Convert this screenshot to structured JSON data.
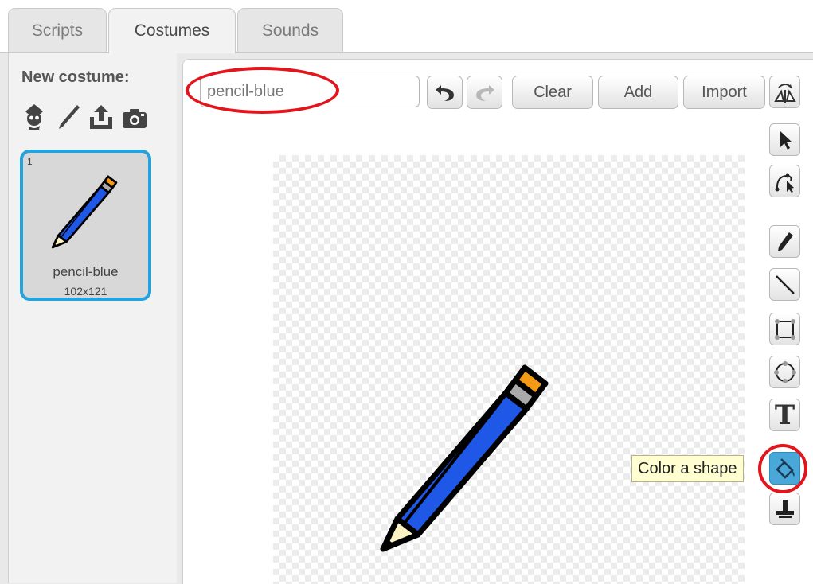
{
  "tabs": [
    {
      "label": "Scripts",
      "active": false
    },
    {
      "label": "Costumes",
      "active": true
    },
    {
      "label": "Sounds",
      "active": false
    }
  ],
  "costume_panel": {
    "new_costume_label": "New costume:",
    "new_costume_icons": [
      "sprite-library-icon",
      "paint-brush-icon",
      "upload-icon",
      "camera-icon"
    ],
    "costumes": [
      {
        "number": "1",
        "name": "pencil-blue",
        "size": "102x121",
        "selected": true
      }
    ]
  },
  "editor": {
    "costume_name": "pencil-blue",
    "toolbar": {
      "undo_icon": "undo-icon",
      "redo_icon": "redo-icon",
      "clear_label": "Clear",
      "add_label": "Add",
      "import_label": "Import",
      "flip_icon": "flip-icon"
    },
    "tools": [
      {
        "name": "select-icon",
        "selected": false
      },
      {
        "name": "reshape-icon",
        "selected": false
      },
      {
        "name": "pencil-icon",
        "selected": false
      },
      {
        "name": "line-icon",
        "selected": false
      },
      {
        "name": "rectangle-icon",
        "selected": false
      },
      {
        "name": "ellipse-icon",
        "selected": false
      },
      {
        "name": "text-icon",
        "glyph": "T",
        "selected": false
      },
      {
        "name": "color-shape-icon",
        "selected": true
      },
      {
        "name": "stamp-icon",
        "selected": false
      }
    ],
    "tooltip": "Color a shape"
  },
  "colors": {
    "accent_selected": "#26a2dc",
    "highlight": "#e3141b",
    "pencil_body": "#1f57e6",
    "pencil_eraser": "#f59a14",
    "tooltip_bg": "#fffed0"
  }
}
